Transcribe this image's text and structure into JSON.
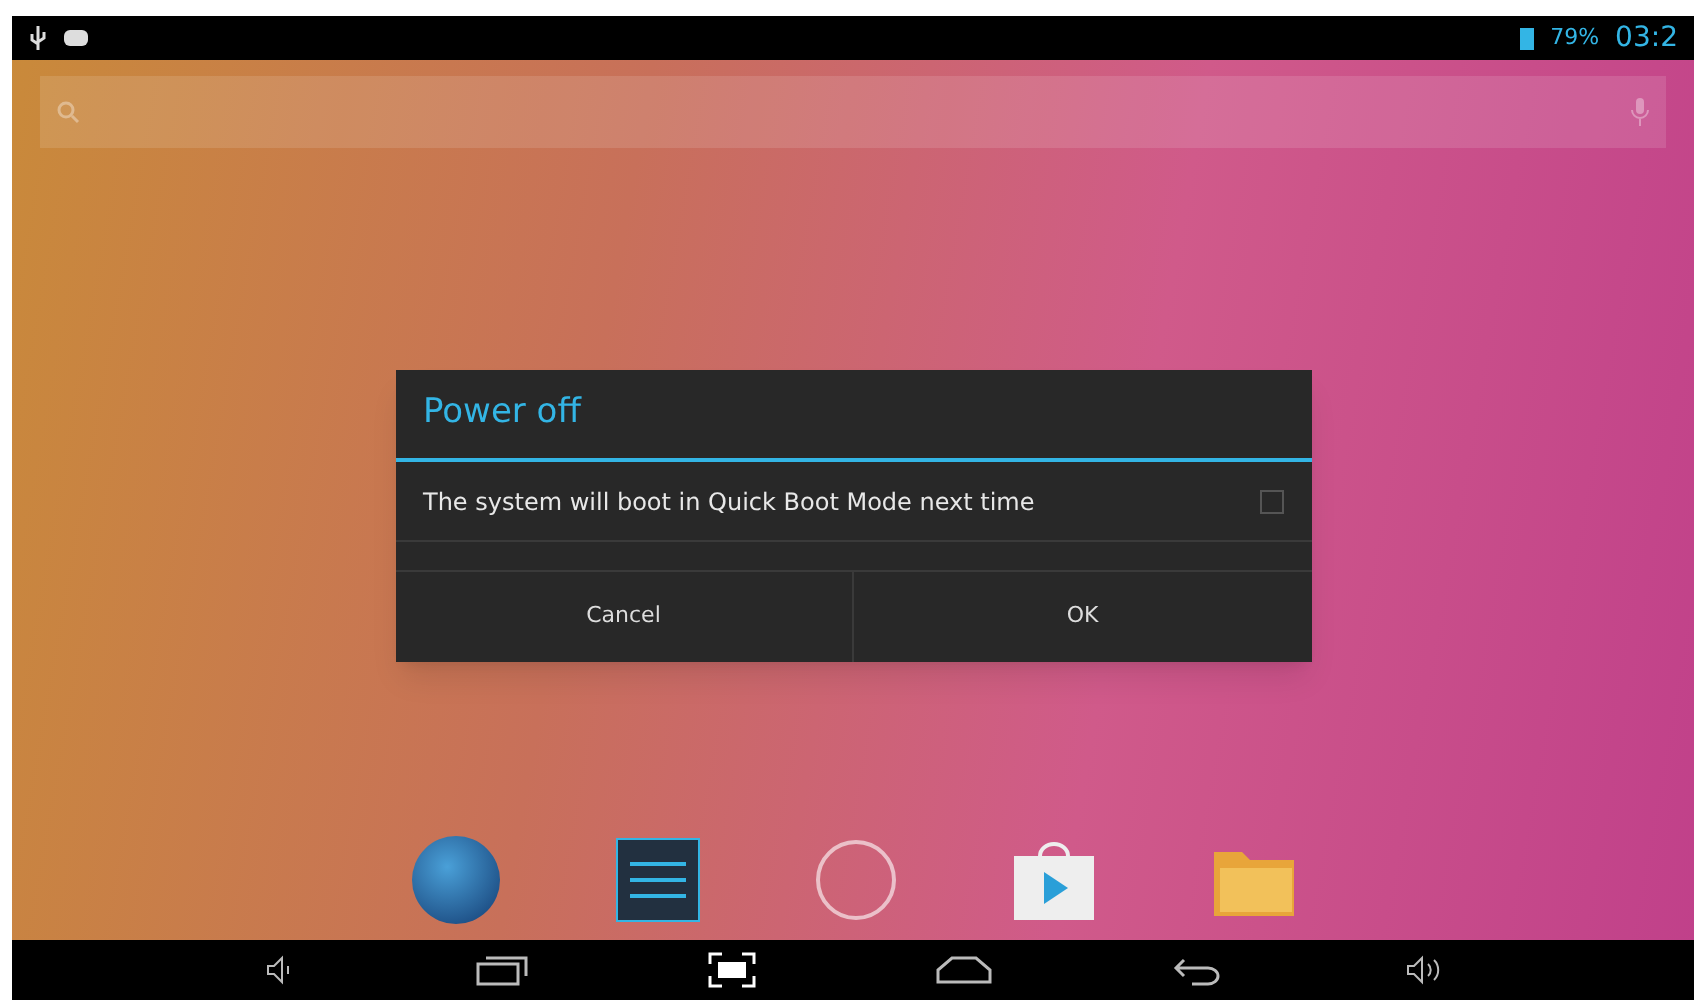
{
  "status_bar": {
    "battery_percent": "79%",
    "time": "03:2"
  },
  "dialog": {
    "title": "Power off",
    "option": {
      "label": "The system will boot in Quick Boot Mode next time",
      "checked": false
    },
    "buttons": [
      "Cancel",
      "OK"
    ]
  }
}
